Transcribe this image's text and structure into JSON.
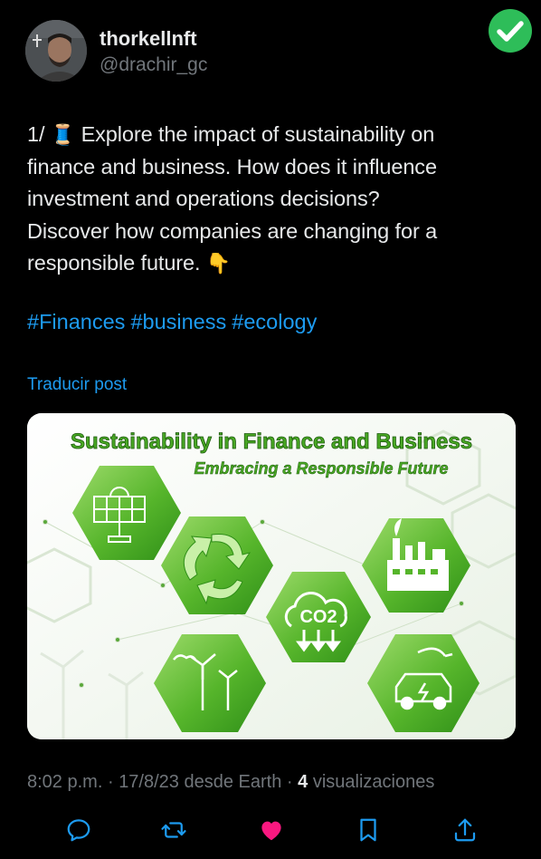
{
  "author": {
    "display_name": "thorkellnft",
    "handle": "@drachir_gc"
  },
  "tweet": {
    "lines": [
      "1/",
      "Explore the impact of sustainability on",
      "finance and business. How does it influence",
      "investment and operations decisions?",
      "Discover how companies are changing for a",
      "responsible future."
    ],
    "emoji_thread": "🧵",
    "emoji_point": "👇",
    "hashtags": [
      "#Finances",
      "#business",
      "#ecology"
    ],
    "translate_label": "Traducir post"
  },
  "image": {
    "title": "Sustainability in Finance and Business",
    "subtitle": "Embracing a Responsible Future",
    "co2_label": "CO2"
  },
  "meta": {
    "time": "8:02 p.m.",
    "sep1": "·",
    "date": "17/8/23",
    "source": "desde Earth",
    "sep2": "·",
    "views_count": "4",
    "views_label": "visualizaciones"
  },
  "colors": {
    "background": "#000000",
    "link": "#1d9bf0",
    "like": "#f91880",
    "muted": "#71767b",
    "verified": "#2ebd59",
    "image_green": "#55b62a"
  }
}
